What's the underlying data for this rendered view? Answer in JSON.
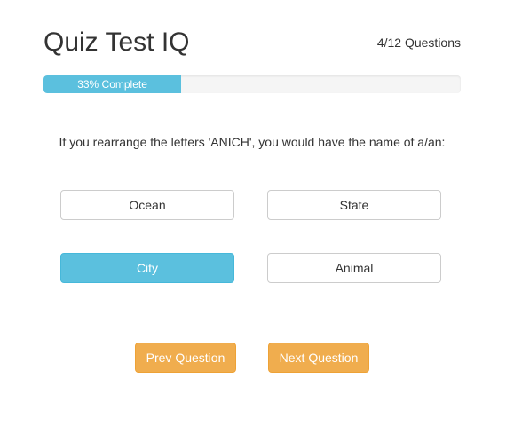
{
  "header": {
    "title": "Quiz Test IQ",
    "question_count": "4/12 Questions"
  },
  "progress": {
    "percent": 33,
    "label": "33% Complete",
    "fill_color": "#5bc0de"
  },
  "question": {
    "text": "If you rearrange the letters 'ANICH', you would have the name of a/an:"
  },
  "answers": [
    {
      "label": "Ocean",
      "selected": false
    },
    {
      "label": "State",
      "selected": false
    },
    {
      "label": "City",
      "selected": true
    },
    {
      "label": "Animal",
      "selected": false
    }
  ],
  "navigation": {
    "prev_label": "Prev Question",
    "next_label": "Next Question",
    "button_color": "#f0ad4e"
  }
}
